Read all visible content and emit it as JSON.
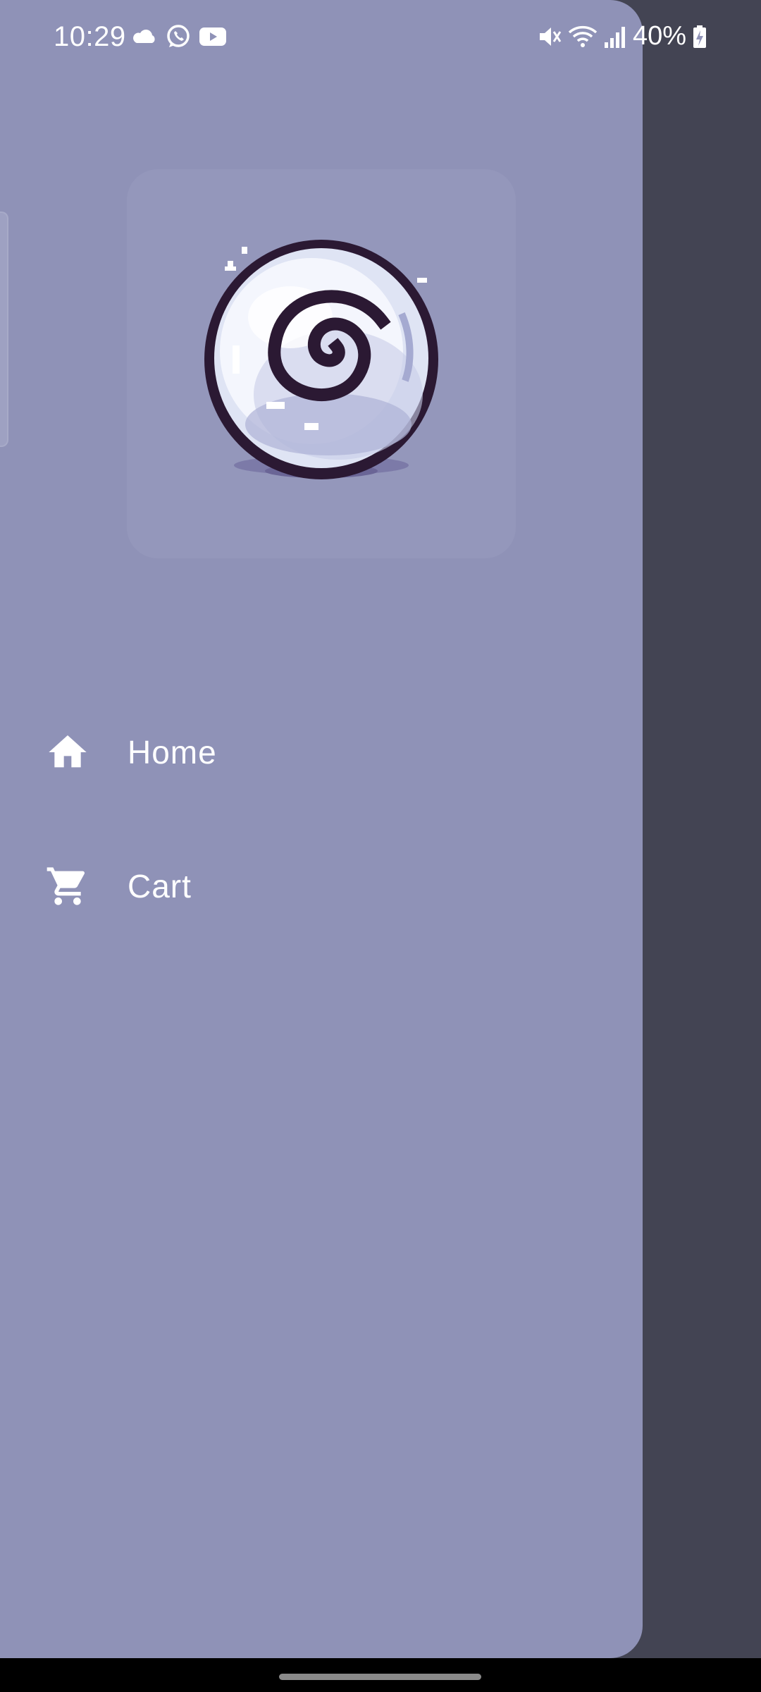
{
  "status_bar": {
    "time": "10:29",
    "battery_percent": "40%",
    "left_icons": [
      "cloud-icon",
      "whatsapp-icon",
      "youtube-icon"
    ],
    "right_icons": [
      "mute-icon",
      "wifi-icon",
      "signal-icon",
      "battery-charging-icon"
    ]
  },
  "drawer": {
    "logo": "snail-shell-logo",
    "items": [
      {
        "label": "Home",
        "icon": "home-icon"
      },
      {
        "label": "Cart",
        "icon": "cart-icon"
      }
    ]
  },
  "colors": {
    "drawer_background": "#8f92b7",
    "scrim": "#434453",
    "text": "#ffffff"
  }
}
